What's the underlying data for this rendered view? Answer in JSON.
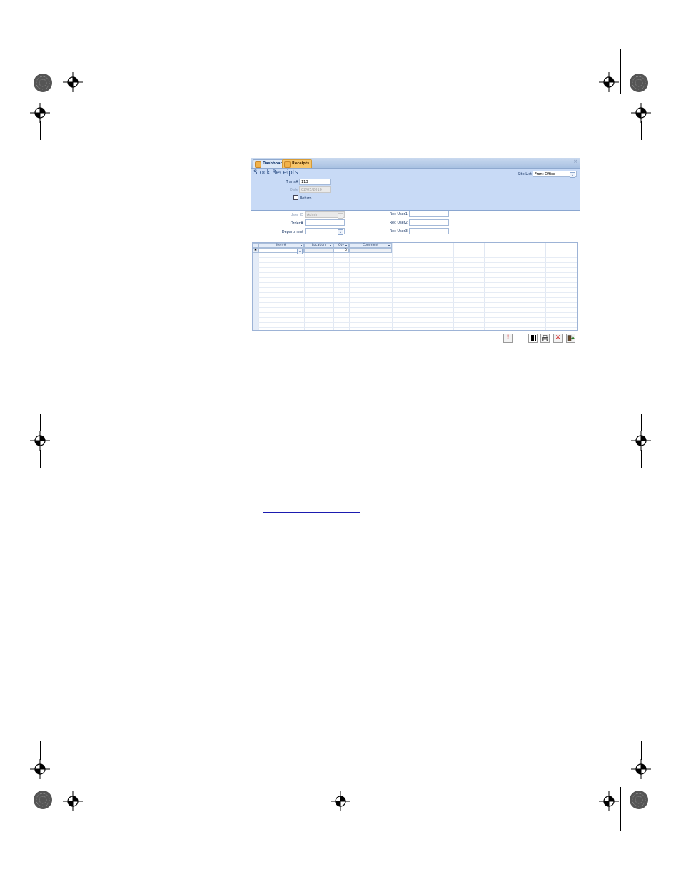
{
  "tabs": [
    {
      "label": "Dashboard",
      "active": false
    },
    {
      "label": "Receipts",
      "active": true
    }
  ],
  "form": {
    "title": "Stock Receipts",
    "site_list_label": "Site List",
    "site_list_value": "Front Office",
    "trans_label": "Trans#",
    "trans_value": "113",
    "date_label": "Date",
    "date_value": "02/05/2010",
    "return_label": "Return",
    "return_checked": false,
    "user_id_label": "User ID",
    "user_id_value": "Admin",
    "order_label": "Order#",
    "order_value": "",
    "department_label": "Department",
    "department_value": "",
    "rec_user1_label": "Rec User1",
    "rec_user2_label": "Rec User2",
    "rec_user3_label": "Rec User3"
  },
  "grid": {
    "columns": [
      "Item#",
      "Location",
      "Qty",
      "Comment"
    ],
    "new_row_marker": "✱",
    "new_row_qty": "0"
  },
  "toolbar": {
    "alert_glyph": "!",
    "close_glyph": "✕"
  },
  "colors": {
    "header_bg": "#c8daf6",
    "active_tab": "#f7c56a",
    "close_red": "#d11f1f"
  }
}
